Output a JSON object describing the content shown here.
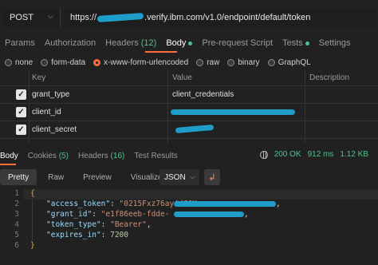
{
  "request": {
    "method": "POST",
    "url_prefix": "https://",
    "url_suffix": ".verify.ibm.com/v1.0/endpoint/default/token"
  },
  "request_tabs": [
    {
      "label": "Params"
    },
    {
      "label": "Authorization"
    },
    {
      "label": "Headers",
      "count": "(12)"
    },
    {
      "label": "Body",
      "active": true
    },
    {
      "label": "Pre-request Script"
    },
    {
      "label": "Tests"
    },
    {
      "label": "Settings"
    }
  ],
  "body_types": [
    "none",
    "form-data",
    "x-www-form-urlencoded",
    "raw",
    "binary",
    "GraphQL"
  ],
  "body_type_selected": "x-www-form-urlencoded",
  "params_table": {
    "headers": {
      "key": "Key",
      "value": "Value",
      "description": "Description"
    },
    "rows": [
      {
        "key": "grant_type",
        "value": "client_credentials"
      },
      {
        "key": "client_id",
        "value": ""
      },
      {
        "key": "client_secret",
        "value": ""
      }
    ]
  },
  "response_tabs": [
    {
      "label": "Body",
      "active": true
    },
    {
      "label": "Cookies",
      "count": "(5)"
    },
    {
      "label": "Headers",
      "count": "(16)"
    },
    {
      "label": "Test Results"
    }
  ],
  "response_status": {
    "code": "200 OK",
    "time": "912 ms",
    "size": "1.12 KB"
  },
  "view_modes": [
    "Pretty",
    "Raw",
    "Preview",
    "Visualize"
  ],
  "format": "JSON",
  "response_lines": [
    {
      "num": "1",
      "text": "{"
    },
    {
      "num": "2",
      "key": "\"access_token\"",
      "value": "\"0215Fxz76ay4dG6X",
      "tail": ","
    },
    {
      "num": "3",
      "key": "\"grant_id\"",
      "value": "\"e1f86eeb-fdde-",
      "tail": ","
    },
    {
      "num": "4",
      "key": "\"token_type\"",
      "value": "\"Bearer\"",
      "tail": ","
    },
    {
      "num": "5",
      "key": "\"expires_in\"",
      "value": "7200",
      "tail": ""
    },
    {
      "num": "6",
      "text": "}"
    }
  ],
  "icons": {
    "method_dropdown": "chevron-down-icon",
    "globe": "globe-icon",
    "wrap": "wrap-lines-icon",
    "checkbox": "checkbox-checked-icon"
  },
  "colors": {
    "accent": "#ff6c37",
    "success": "#4cc38a",
    "redaction": "#1e9dc9"
  }
}
